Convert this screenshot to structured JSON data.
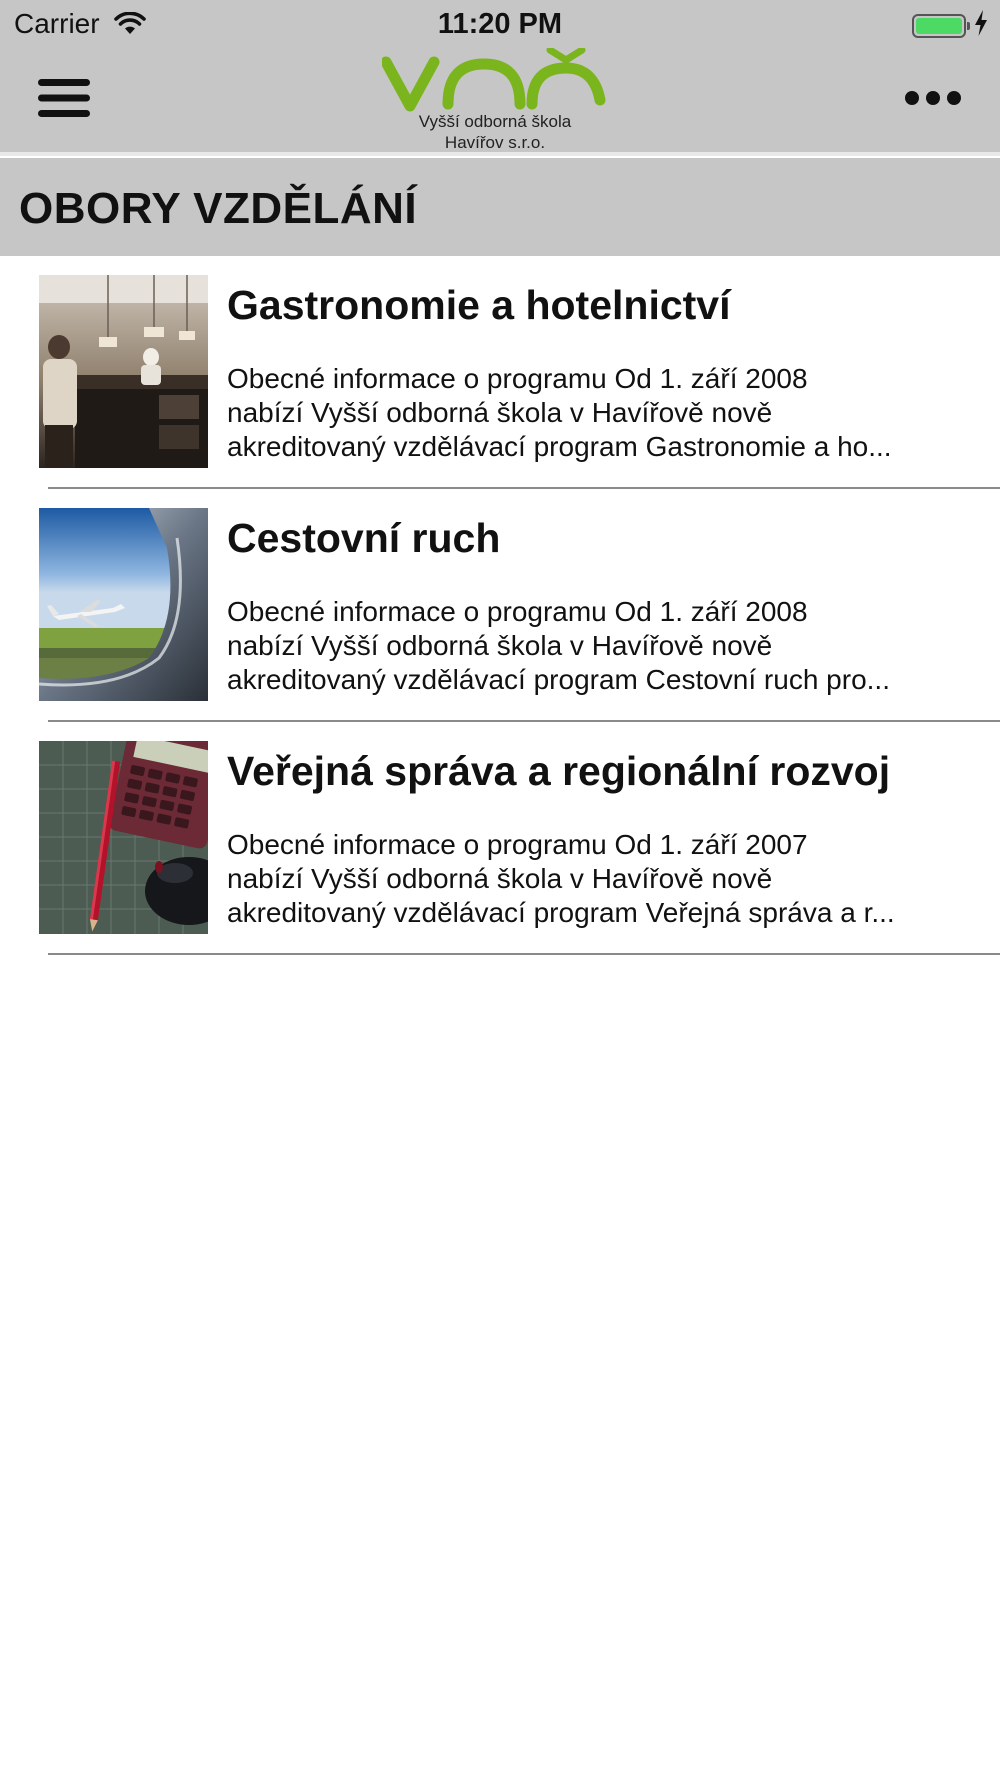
{
  "status_bar": {
    "carrier": "Carrier",
    "time": "11:20 PM",
    "battery_level": 1.0,
    "battery_color": "#4cd964",
    "icons": [
      "wifi-icon",
      "battery-icon",
      "charging-bolt-icon"
    ]
  },
  "nav": {
    "menu_icon": "hamburger-menu-icon",
    "more_icon": "more-dots-icon",
    "logo": {
      "mark": "VOŠ",
      "line1": "Vyšší odborná škola",
      "line2": "Havířov s.r.o.",
      "color": "#7ab51d"
    }
  },
  "section": {
    "title": "OBORY VZDĚLÁNÍ"
  },
  "programs": [
    {
      "title": "Gastronomie a hotelnictví",
      "description": "Obecné informace o programu  Od 1. září 2008\nnabízí Vyšší odborná škola v Havířově nově\nakreditovaný vzdělávací program Gastronomie a ho...",
      "image": "kitchen-photo"
    },
    {
      "title": "Cestovní ruch",
      "description": "Obecné informace o programu  Od 1. září 2008\nnabízí Vyšší odborná škola v Havířově nově\nakreditovaný vzdělávací program Cestovní ruch pro...",
      "image": "airplane-mirror-photo"
    },
    {
      "title": "Veřejná správa a regionální rozvoj",
      "description": "Obecné informace o programu  Od 1. září 2007\nnabízí Vyšší odborná škola v Havířově nově\nakreditovaný vzdělávací program Veřejná správa a r...",
      "image": "calculator-pencil-photo"
    }
  ]
}
